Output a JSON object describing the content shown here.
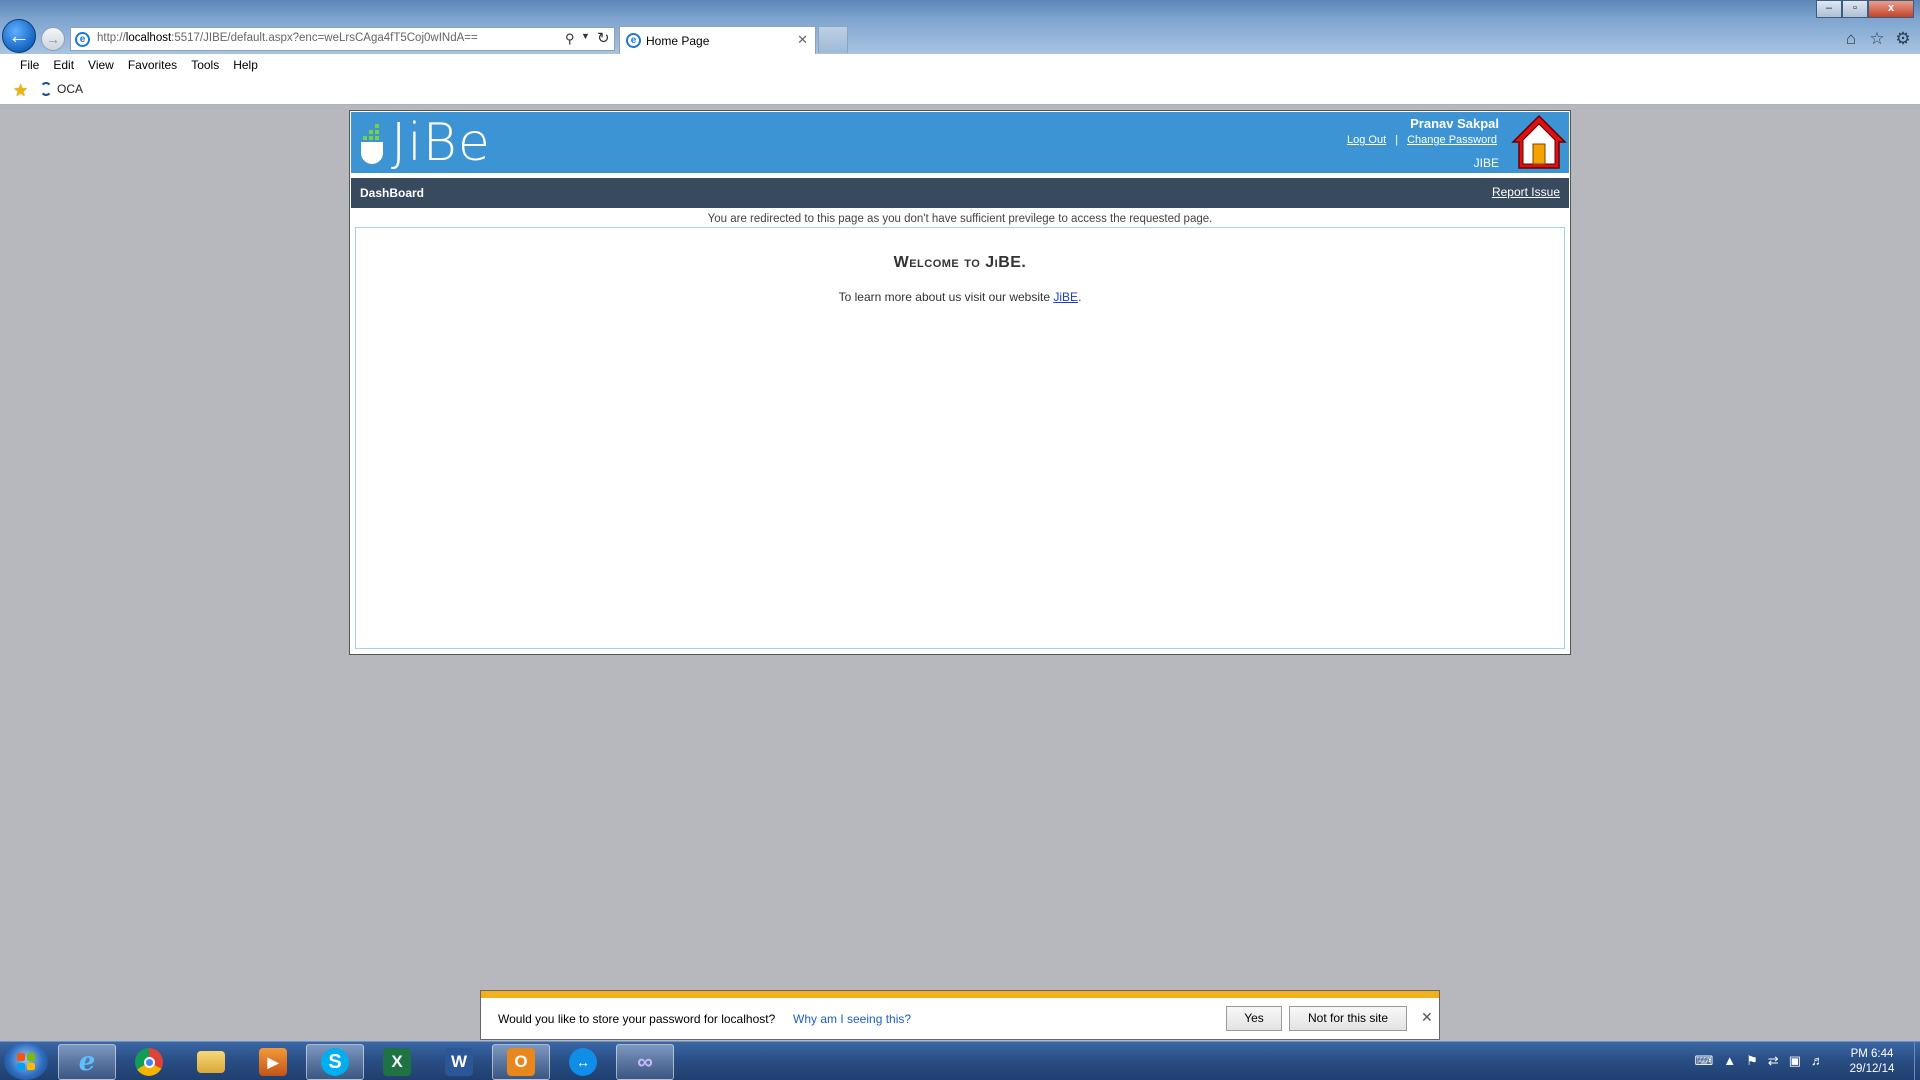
{
  "browser": {
    "address_prefix": "http://",
    "address_host": "localhost",
    "address_rest": ":5517/JIBE/default.aspx?enc=weLrsCAga4fT5Coj0wINdA==",
    "tab_title": "Home Page",
    "menu": [
      "File",
      "Edit",
      "View",
      "Favorites",
      "Tools",
      "Help"
    ],
    "favorites": [
      {
        "label": "OCA"
      }
    ],
    "window_controls": [
      "–",
      "▫",
      "x"
    ]
  },
  "app": {
    "logo_text": "JiBe",
    "user_name": "Pranav Sakpal",
    "logout_label": "Log Out",
    "separator": "|",
    "change_password_label": "Change Password",
    "app_code": "JIBE",
    "nav_title": "DashBoard",
    "report_issue_label": "Report Issue",
    "redirect_message": "You are redirected to this page as you don't have sufficient previlege to access the requested page.",
    "welcome_title": "Welcome to JiBE.",
    "welcome_text_before": "To learn more about us visit our website ",
    "welcome_link": "JiBE",
    "welcome_text_after": "."
  },
  "password_bar": {
    "question": "Would you like to store your password for localhost?",
    "why_link": "Why am I seeing this?",
    "yes_label": "Yes",
    "no_label": "Not for this site",
    "accent_color": "#f2b01e"
  },
  "taskbar": {
    "apps": [
      {
        "name": "internet-explorer",
        "active": true
      },
      {
        "name": "chrome",
        "active": false
      },
      {
        "name": "file-explorer",
        "active": false
      },
      {
        "name": "media-player",
        "active": false
      },
      {
        "name": "skype",
        "active": true
      },
      {
        "name": "excel",
        "active": false
      },
      {
        "name": "word",
        "active": false
      },
      {
        "name": "outlook",
        "active": true
      },
      {
        "name": "teamviewer",
        "active": false
      },
      {
        "name": "visual-studio",
        "active": true
      }
    ],
    "clock_time": "PM 6:44",
    "clock_date": "29/12/14"
  },
  "colors": {
    "header_blue": "#3c94d4",
    "navbar_dark": "#384a5e",
    "page_bg": "#b6b8bd",
    "link_blue": "#1a3ecb"
  }
}
